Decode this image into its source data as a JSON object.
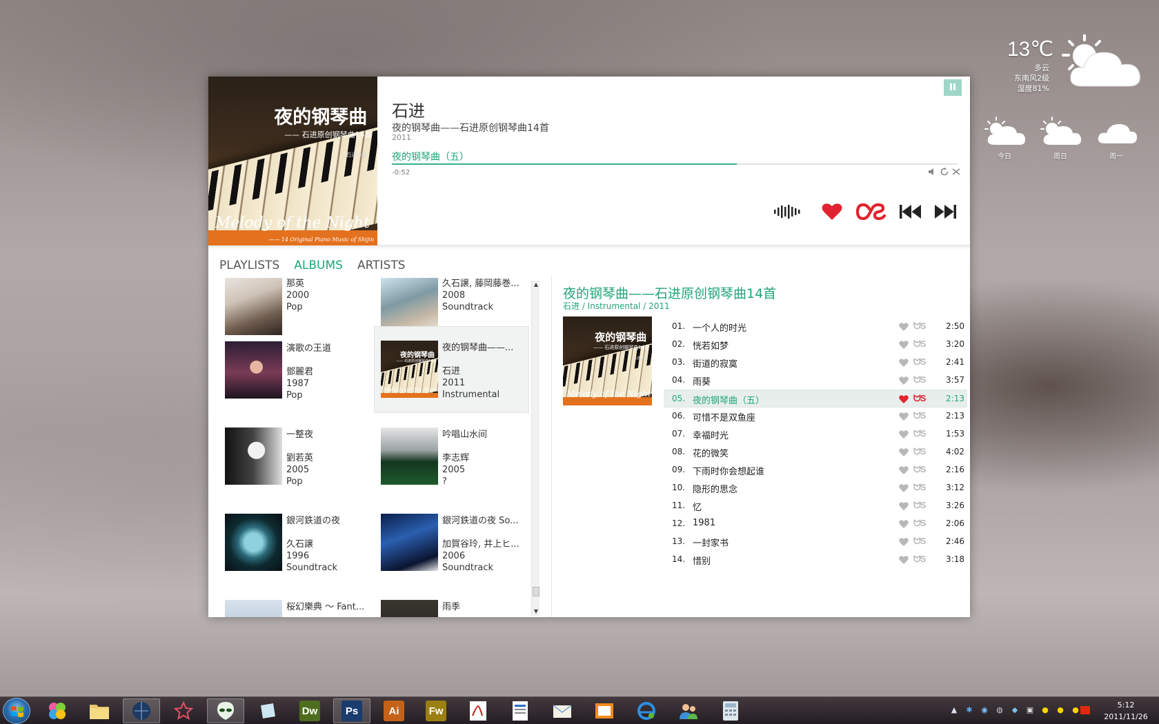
{
  "weather": {
    "temperature": "13℃",
    "condition": "多云",
    "wind": "东南风2级",
    "humidity": "湿度81%",
    "forecast": [
      {
        "day": "今日",
        "icon": "partly-cloudy-icon"
      },
      {
        "day": "周日",
        "icon": "partly-cloudy-icon"
      },
      {
        "day": "周一",
        "icon": "cloudy-icon"
      }
    ]
  },
  "now_playing": {
    "artist": "石进",
    "album": "夜的钢琴曲——石进原创钢琴曲14首",
    "year": "2011",
    "track": "夜的钢琴曲（五）",
    "remaining": "-0:52",
    "progress": 0.61,
    "art": {
      "title": "夜的钢琴曲",
      "subtitle": "—— 石进原创钢琴曲14首",
      "credit": "石进◎著",
      "english": "Melody of the Night",
      "english_sub": "—— 14 Original Piano Music of  Shijin"
    }
  },
  "tabs": [
    {
      "label": "PLAYLISTS",
      "active": false
    },
    {
      "label": "ALBUMS",
      "active": true
    },
    {
      "label": "ARTISTS",
      "active": false
    }
  ],
  "albums": [
    {
      "name": "",
      "artist": "那英",
      "year": "2000",
      "genre": "Pop",
      "style": "photo"
    },
    {
      "name": "",
      "artist": "久石譲, 藤岡藤巻...",
      "year": "2008",
      "genre": "Soundtrack",
      "style": "water"
    },
    {
      "name": "演歌の王道",
      "artist": "鄧麗君",
      "year": "1987",
      "genre": "Pop",
      "style": "singer"
    },
    {
      "name": "夜的钢琴曲——...",
      "artist": "石进",
      "year": "2011",
      "genre": "Instrumental",
      "style": "piano",
      "selected": true
    },
    {
      "name": "一整夜",
      "artist": "劉若英",
      "year": "2005",
      "genre": "Pop",
      "style": "bw"
    },
    {
      "name": "吟唱山水间",
      "artist": "李志辉",
      "year": "2005",
      "genre": "?",
      "style": "green"
    },
    {
      "name": "銀河鉄道の夜",
      "artist": "久石譲",
      "year": "1996",
      "genre": "Soundtrack",
      "style": "globe"
    },
    {
      "name": "銀河鉄道の夜 So...",
      "artist": "加賀谷玲, 井上ヒ...",
      "year": "2006",
      "genre": "Soundtrack",
      "style": "night"
    },
    {
      "name": "桜幻樂典 ～ Fant...",
      "artist": "",
      "year": "",
      "genre": "",
      "style": "sky"
    },
    {
      "name": "雨季",
      "artist": "",
      "year": "",
      "genre": "",
      "style": "dark"
    }
  ],
  "detail": {
    "title": "夜的钢琴曲——石进原创钢琴曲14首",
    "subtitle": "石进 / Instrumental / 2011",
    "lastfm_label": "ᗢS",
    "tracks": [
      {
        "num": "01.",
        "name": "一个人的时光",
        "duration": "2:50"
      },
      {
        "num": "02.",
        "name": "恍若如梦",
        "duration": "3:20"
      },
      {
        "num": "03.",
        "name": "街道的寂寞",
        "duration": "2:41"
      },
      {
        "num": "04.",
        "name": "雨葵",
        "duration": "3:57"
      },
      {
        "num": "05.",
        "name": "夜的钢琴曲（五）",
        "duration": "2:13",
        "playing": true
      },
      {
        "num": "06.",
        "name": "可惜不是双鱼座",
        "duration": "2:13"
      },
      {
        "num": "07.",
        "name": "幸福时光",
        "duration": "1:53"
      },
      {
        "num": "08.",
        "name": "花的微笑",
        "duration": "4:02"
      },
      {
        "num": "09.",
        "name": "下雨时你会想起谁",
        "duration": "2:16"
      },
      {
        "num": "10.",
        "name": "隐形的思念",
        "duration": "3:12"
      },
      {
        "num": "11.",
        "name": "忆",
        "duration": "3:26"
      },
      {
        "num": "12.",
        "name": "1981",
        "duration": "2:06"
      },
      {
        "num": "13.",
        "name": "一封家书",
        "duration": "2:46"
      },
      {
        "num": "14.",
        "name": "惜别",
        "duration": "3:18"
      }
    ]
  },
  "colors": {
    "accent": "#21a47a",
    "love": "#e0232e",
    "controls": "#222222"
  },
  "taskbar": {
    "apps": [
      {
        "label": "",
        "icon": "pinwheel-icon",
        "bg": "transparent"
      },
      {
        "label": "",
        "icon": "folder-icon",
        "bg": "transparent"
      },
      {
        "label": "",
        "icon": "globe-app-icon",
        "bg": "transparent",
        "active": true
      },
      {
        "label": "",
        "icon": "star-app-icon",
        "bg": "transparent"
      },
      {
        "label": "",
        "icon": "alien-app-icon",
        "bg": "transparent",
        "active": true
      },
      {
        "label": "",
        "icon": "notes-app-icon",
        "bg": "transparent"
      },
      {
        "label": "Dw",
        "icon": "dreamweaver-icon",
        "bg": "#4e6d1f"
      },
      {
        "label": "Ps",
        "icon": "photoshop-icon",
        "bg": "#1a3c6e",
        "active": true
      },
      {
        "label": "Ai",
        "icon": "illustrator-icon",
        "bg": "#c4621a"
      },
      {
        "label": "Fw",
        "icon": "fireworks-icon",
        "bg": "#9b7f12"
      },
      {
        "label": "",
        "icon": "acrobat-icon",
        "bg": "transparent"
      },
      {
        "label": "",
        "icon": "document-icon",
        "bg": "transparent"
      },
      {
        "label": "",
        "icon": "mail-icon",
        "bg": "transparent"
      },
      {
        "label": "",
        "icon": "media-icon",
        "bg": "transparent"
      },
      {
        "label": "",
        "icon": "ie-icon",
        "bg": "transparent"
      },
      {
        "label": "",
        "icon": "contacts-icon",
        "bg": "transparent"
      },
      {
        "label": "",
        "icon": "calculator-icon",
        "bg": "transparent"
      }
    ],
    "time": "5:12",
    "date": "2011/11/26"
  }
}
